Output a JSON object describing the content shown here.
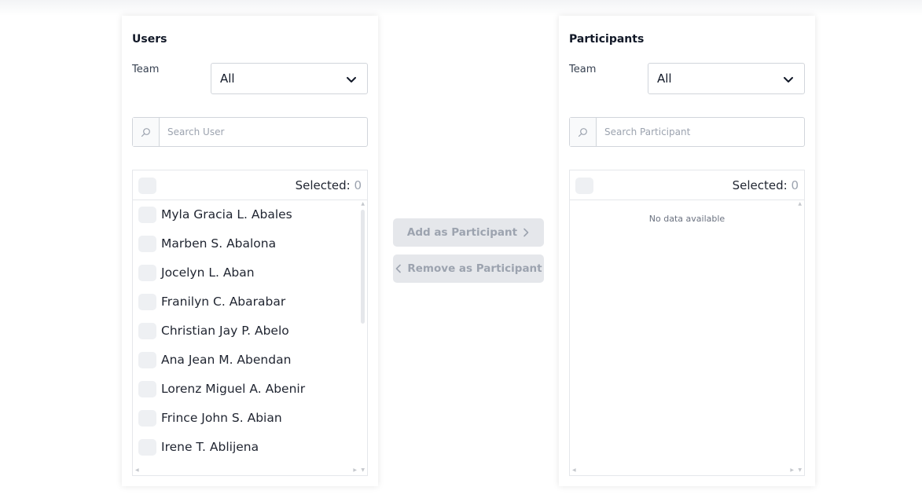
{
  "users_panel": {
    "title": "Users",
    "team_label": "Team",
    "team_value": "All",
    "search_placeholder": "Search User",
    "selected_label": "Selected:",
    "selected_count": "0",
    "users": [
      "Myla Gracia L. Abales",
      "Marben S. Abalona",
      "Jocelyn L. Aban",
      "Franilyn C. Abarabar",
      "Christian Jay P. Abelo",
      "Ana Jean M. Abendan",
      "Lorenz Miguel A. Abenir",
      "Frince John S. Abian",
      "Irene T. Ablijena"
    ]
  },
  "participants_panel": {
    "title": "Participants",
    "team_label": "Team",
    "team_value": "All",
    "search_placeholder": "Search Participant",
    "selected_label": "Selected:",
    "selected_count": "0",
    "empty_text": "No data available"
  },
  "actions": {
    "add_label": "Add as Participant",
    "remove_label": "Remove as Participant"
  },
  "icons": {
    "search": "search-icon",
    "dropdown": "chevron-down-icon",
    "add": "chevron-right-icon",
    "remove": "chevron-left-icon"
  },
  "colors": {
    "button_bg": "#e5e7eb",
    "button_text": "#9ca3af",
    "checkbox_bg": "#eef0f3"
  }
}
